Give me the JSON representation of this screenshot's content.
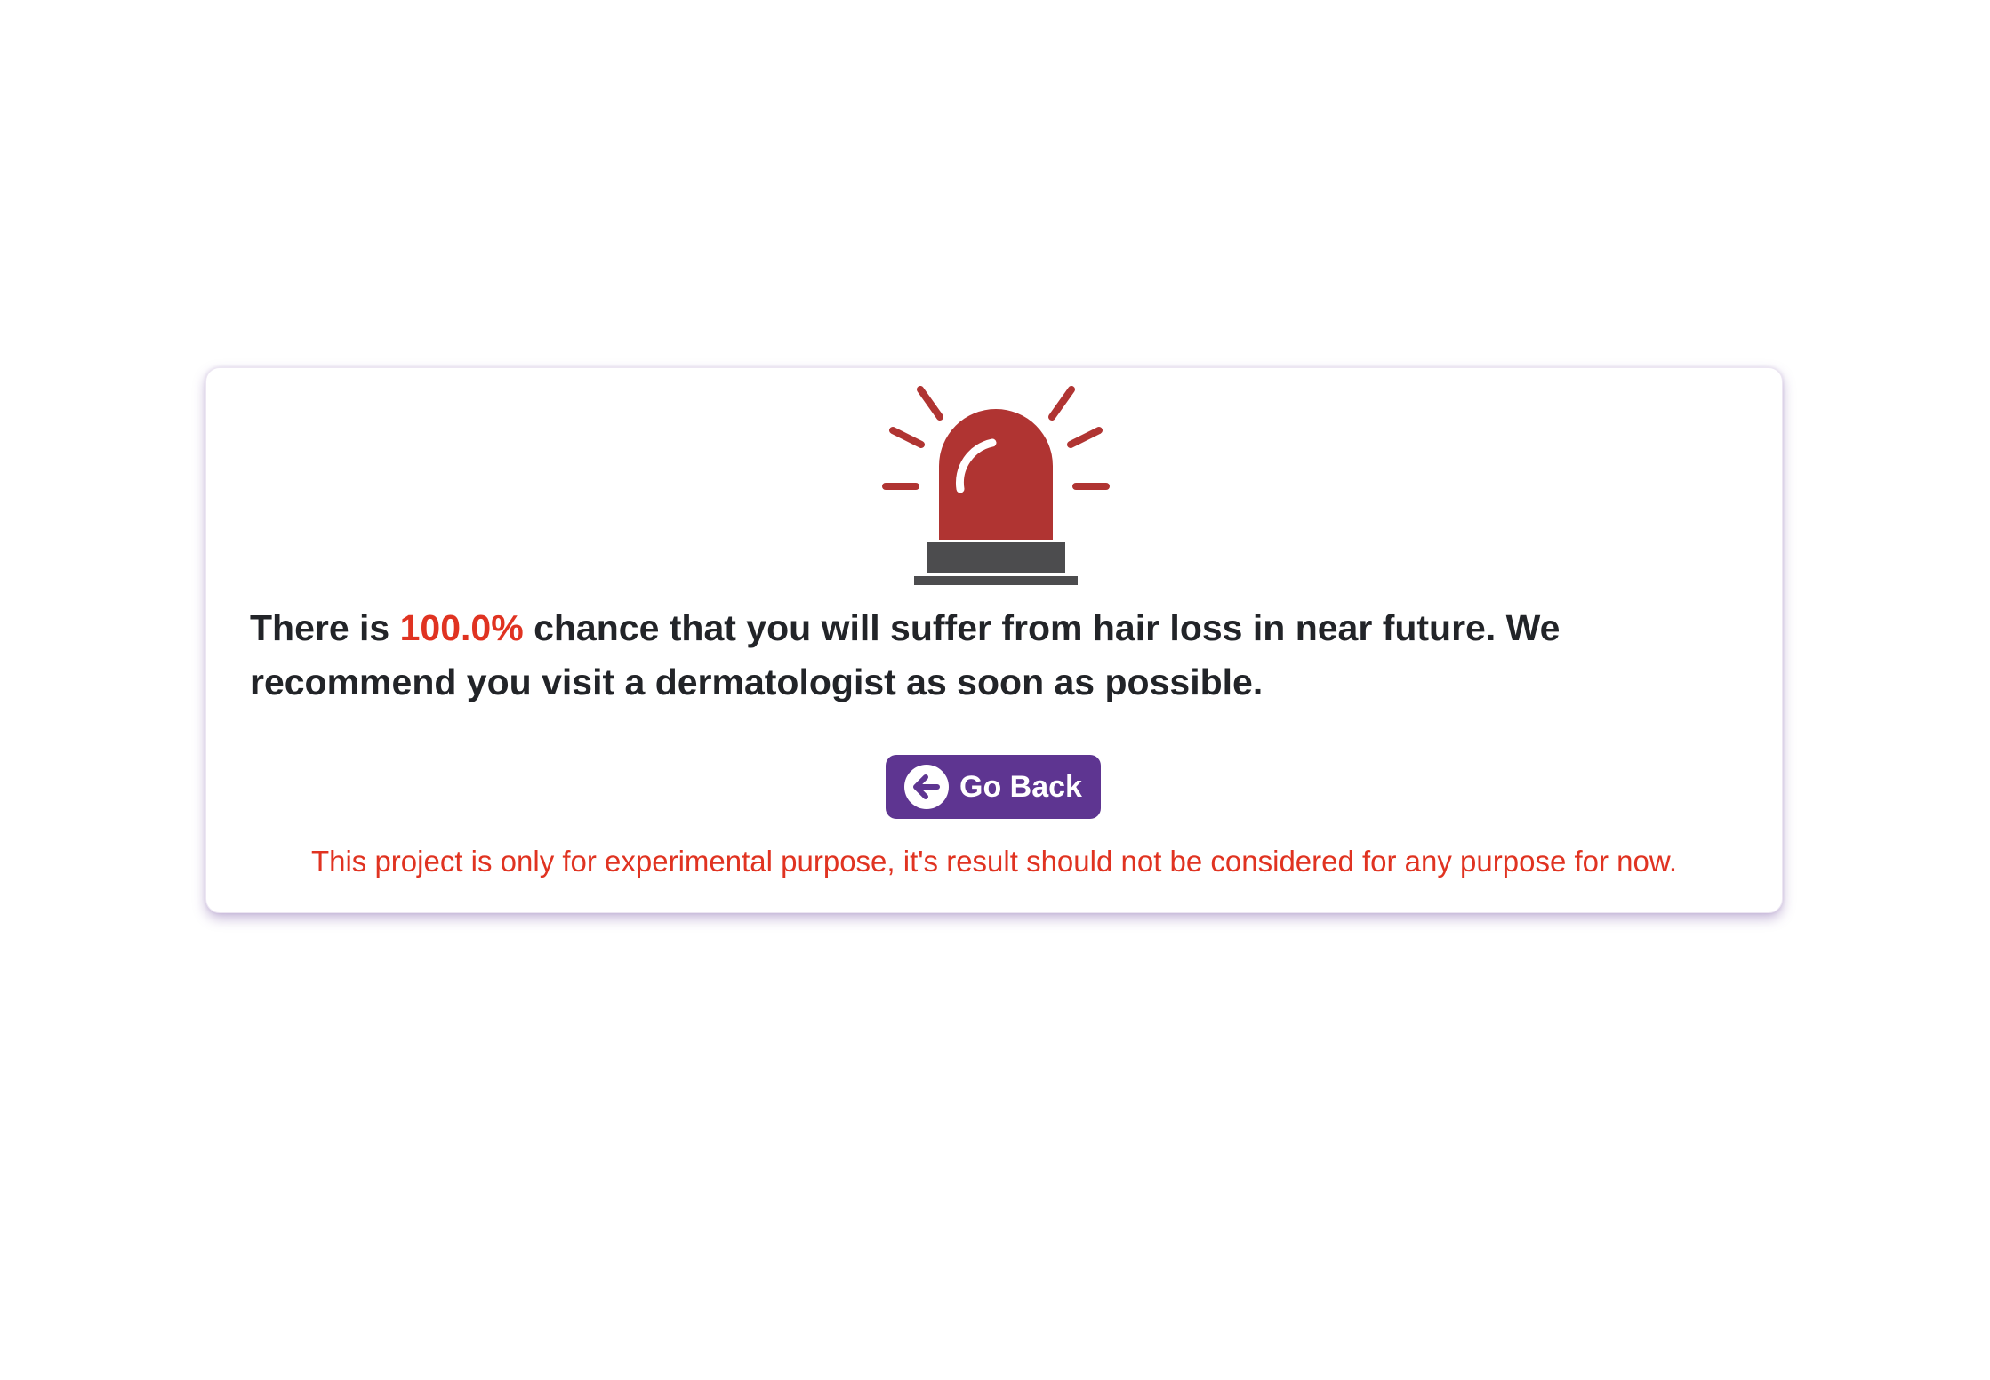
{
  "alert": {
    "icon": "siren-icon",
    "message_prefix": "There is ",
    "percentage": "100.0%",
    "message_suffix": " chance that you will suffer from hair loss in near future. We recommend you visit a dermatologist as soon as possible."
  },
  "actions": {
    "go_back_label": "Go Back",
    "go_back_icon": "arrow-left-circle-icon"
  },
  "disclaimer": "This project is only for experimental purpose, it's result should not be considered for any purpose for now.",
  "colors": {
    "accent_red": "#e03321",
    "siren_red": "#b03432",
    "button_purple": "#5e3591",
    "text_dark": "#222428"
  }
}
